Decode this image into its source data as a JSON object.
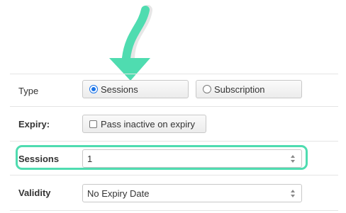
{
  "colors": {
    "accent": "#4fdcb0",
    "radio_selected": "#1a73e8"
  },
  "arrow": {
    "icon": "arrow-down-icon"
  },
  "type_row": {
    "label": "Type",
    "options": [
      {
        "label": "Sessions",
        "selected": true
      },
      {
        "label": "Subscription",
        "selected": false
      }
    ]
  },
  "expiry_row": {
    "label": "Expiry:",
    "checkbox_label": "Pass inactive on expiry",
    "checked": false
  },
  "sessions_row": {
    "label": "Sessions",
    "value": "1"
  },
  "validity_row": {
    "label": "Validity",
    "value": "No Expiry Date"
  }
}
